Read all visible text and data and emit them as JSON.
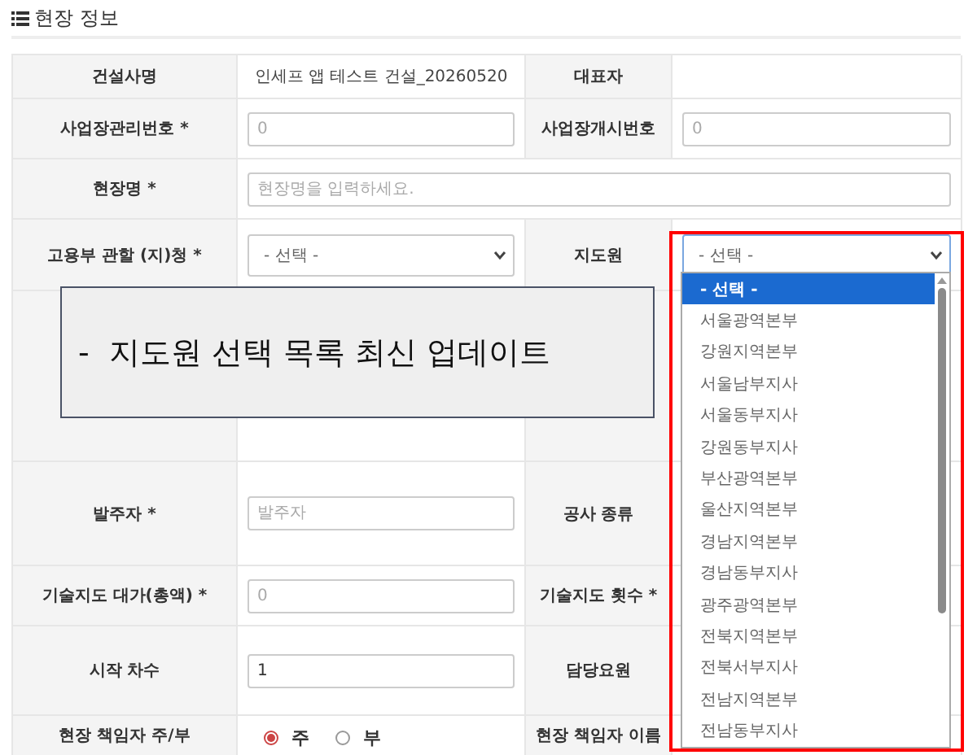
{
  "section": {
    "title": "현장 정보"
  },
  "rows": [
    {
      "kind": "cells",
      "cells": [
        {
          "kind": "label",
          "text": "건설사명"
        },
        {
          "kind": "text",
          "text": "인세프 앱 테스트 건설_20260520"
        },
        {
          "kind": "label",
          "text": "대표자"
        },
        {
          "kind": "empty"
        }
      ]
    },
    {
      "kind": "cells",
      "cells": [
        {
          "kind": "label",
          "text": "사업장관리번호 *"
        },
        {
          "kind": "input",
          "placeholder": "0"
        },
        {
          "kind": "label",
          "text": "사업장개시번호"
        },
        {
          "kind": "input",
          "placeholder": "0"
        }
      ]
    },
    {
      "kind": "cells",
      "cells": [
        {
          "kind": "label",
          "text": "현장명 *"
        },
        {
          "kind": "wide-input",
          "placeholder": "현장명을 입력하세요."
        }
      ]
    },
    {
      "kind": "cells",
      "cells": [
        {
          "kind": "label",
          "text": "고용부 관할 (지)청 *"
        },
        {
          "kind": "select",
          "value": "- 선택 -"
        },
        {
          "kind": "label",
          "text": "지도원"
        },
        {
          "kind": "select",
          "value": "- 선택 -",
          "open": true
        }
      ]
    },
    {
      "kind": "blank"
    },
    {
      "kind": "cells",
      "cells": [
        {
          "kind": "label",
          "text": "발주자 *"
        },
        {
          "kind": "input",
          "placeholder": "발주자"
        },
        {
          "kind": "label",
          "text": "공사 종류"
        },
        {
          "kind": "empty"
        }
      ]
    },
    {
      "kind": "cells",
      "cells": [
        {
          "kind": "label",
          "text": "기술지도 대가(총액) *"
        },
        {
          "kind": "input",
          "placeholder": "0"
        },
        {
          "kind": "label",
          "text": "기술지도 횟수 *"
        },
        {
          "kind": "empty"
        }
      ]
    },
    {
      "kind": "cells",
      "cells": [
        {
          "kind": "label",
          "text": "시작 차수"
        },
        {
          "kind": "input",
          "value": "1"
        },
        {
          "kind": "label",
          "text": "담당요원"
        },
        {
          "kind": "empty"
        }
      ]
    },
    {
      "kind": "cells",
      "cells": [
        {
          "kind": "label",
          "text": "현장 책임자 주/부"
        },
        {
          "kind": "radio",
          "options": [
            {
              "label": "주",
              "selected": true
            },
            {
              "label": "부",
              "selected": false
            }
          ]
        },
        {
          "kind": "label",
          "text": "현장 책임자 이름"
        },
        {
          "kind": "empty"
        }
      ]
    }
  ],
  "note": {
    "text": "-  지도원 선택 목록 최신 업데이트"
  },
  "dropdown_list": {
    "options": [
      {
        "label": "- 선택 -",
        "selected": true
      },
      {
        "label": "서울광역본부",
        "selected": false
      },
      {
        "label": "강원지역본부",
        "selected": false
      },
      {
        "label": "서울남부지사",
        "selected": false
      },
      {
        "label": "서울동부지사",
        "selected": false
      },
      {
        "label": "강원동부지사",
        "selected": false
      },
      {
        "label": "부산광역본부",
        "selected": false
      },
      {
        "label": "울산지역본부",
        "selected": false
      },
      {
        "label": "경남지역본부",
        "selected": false
      },
      {
        "label": "경남동부지사",
        "selected": false
      },
      {
        "label": "광주광역본부",
        "selected": false
      },
      {
        "label": "전북지역본부",
        "selected": false
      },
      {
        "label": "전북서부지사",
        "selected": false
      },
      {
        "label": "전남지역본부",
        "selected": false
      },
      {
        "label": "전남동부지사",
        "selected": false
      }
    ]
  }
}
